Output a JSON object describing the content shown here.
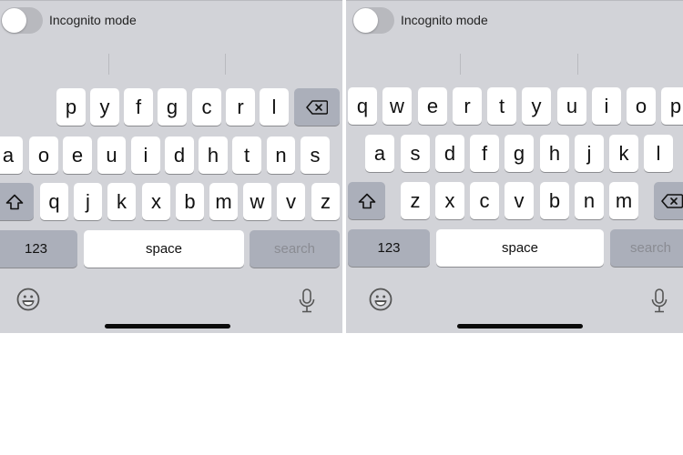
{
  "left_keyboard": {
    "layout": "dvorak",
    "toggle_label": "Incognito mode",
    "toggle_on": false,
    "row1": [
      "p",
      "y",
      "f",
      "g",
      "c",
      "r",
      "l"
    ],
    "row2": [
      "a",
      "o",
      "e",
      "u",
      "i",
      "d",
      "h",
      "t",
      "n",
      "s"
    ],
    "row3": [
      "q",
      "j",
      "k",
      "x",
      "b",
      "m",
      "w",
      "v",
      "z"
    ],
    "numbers_label": "123",
    "space_label": "space",
    "action_label": "search"
  },
  "right_keyboard": {
    "layout": "qwerty",
    "toggle_label": "Incognito mode",
    "toggle_on": false,
    "row1": [
      "q",
      "w",
      "e",
      "r",
      "t",
      "y",
      "u",
      "i",
      "o",
      "p"
    ],
    "row2": [
      "a",
      "s",
      "d",
      "f",
      "g",
      "h",
      "j",
      "k",
      "l"
    ],
    "row3": [
      "z",
      "x",
      "c",
      "v",
      "b",
      "n",
      "m"
    ],
    "numbers_label": "123",
    "space_label": "space",
    "action_label": "search"
  },
  "icons": {
    "backspace": "backspace-icon",
    "shift": "shift-icon",
    "emoji": "emoji-icon",
    "mic": "microphone-icon"
  }
}
